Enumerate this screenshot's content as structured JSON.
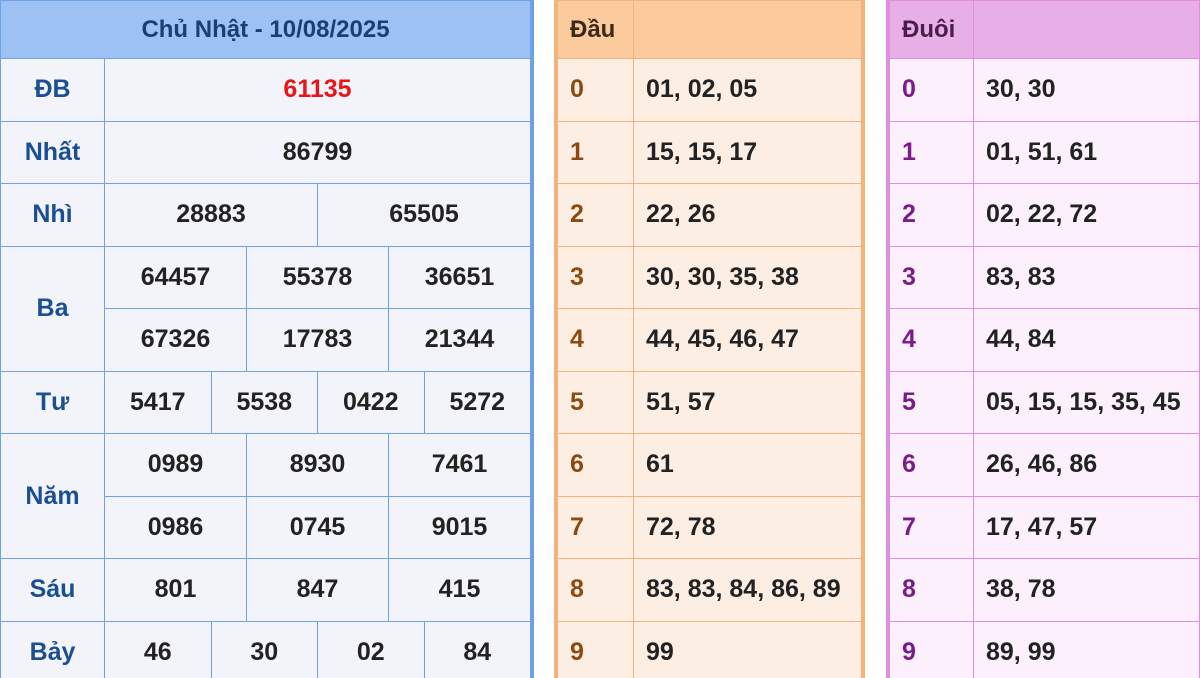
{
  "results": {
    "title": "Chủ Nhật - 10/08/2025",
    "rows": {
      "db": {
        "label": "ĐB",
        "values": [
          "61135"
        ]
      },
      "nhat": {
        "label": "Nhất",
        "values": [
          "86799"
        ]
      },
      "nhi": {
        "label": "Nhì",
        "values": [
          "28883",
          "65505"
        ]
      },
      "ba": {
        "label": "Ba",
        "values": [
          "64457",
          "55378",
          "36651",
          "67326",
          "17783",
          "21344"
        ]
      },
      "tu": {
        "label": "Tư",
        "values": [
          "5417",
          "5538",
          "0422",
          "5272"
        ]
      },
      "nam": {
        "label": "Năm",
        "values": [
          "0989",
          "8930",
          "7461",
          "0986",
          "0745",
          "9015"
        ]
      },
      "sau": {
        "label": "Sáu",
        "values": [
          "801",
          "847",
          "415"
        ]
      },
      "bay": {
        "label": "Bảy",
        "values": [
          "46",
          "30",
          "02",
          "84"
        ]
      }
    }
  },
  "dau": {
    "header": "Đầu",
    "rows": [
      {
        "key": "0",
        "val": "01, 02, 05"
      },
      {
        "key": "1",
        "val": "15, 15, 17"
      },
      {
        "key": "2",
        "val": "22, 26"
      },
      {
        "key": "3",
        "val": "30, 30, 35, 38"
      },
      {
        "key": "4",
        "val": "44, 45, 46, 47"
      },
      {
        "key": "5",
        "val": "51, 57"
      },
      {
        "key": "6",
        "val": "61"
      },
      {
        "key": "7",
        "val": "72, 78"
      },
      {
        "key": "8",
        "val": "83, 83, 84, 86, 89"
      },
      {
        "key": "9",
        "val": "99"
      }
    ]
  },
  "duoi": {
    "header": "Đuôi",
    "rows": [
      {
        "key": "0",
        "val": "30, 30"
      },
      {
        "key": "1",
        "val": "01, 51, 61"
      },
      {
        "key": "2",
        "val": "02, 22, 72"
      },
      {
        "key": "3",
        "val": "83, 83"
      },
      {
        "key": "4",
        "val": "44, 84"
      },
      {
        "key": "5",
        "val": "05, 15, 15, 35, 45"
      },
      {
        "key": "6",
        "val": "26, 46, 86"
      },
      {
        "key": "7",
        "val": "17, 47, 57"
      },
      {
        "key": "8",
        "val": "38, 78"
      },
      {
        "key": "9",
        "val": "89, 99"
      }
    ]
  },
  "colors": {
    "special_prize": "#e8151a",
    "results_header": "#9cc1f2",
    "dau_header": "#fbcb9e",
    "duoi_header": "#e8aee8"
  }
}
